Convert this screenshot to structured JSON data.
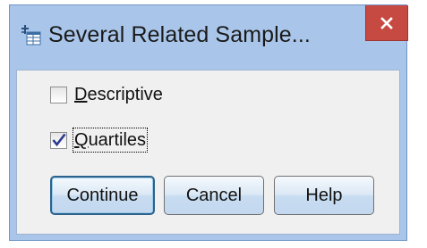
{
  "window": {
    "title": "Several Related Sample...",
    "title_icon": "spss-dialog-icon",
    "close_icon": "close-icon",
    "close_color": "#c74a42",
    "title_bar_color": "#a9c6ea"
  },
  "options": [
    {
      "label_prefix": "",
      "label_mnemonic": "D",
      "label_rest": "escriptive",
      "checked": false
    },
    {
      "label_prefix": "",
      "label_mnemonic": "Q",
      "label_rest": "uartiles",
      "checked": true
    }
  ],
  "buttons": {
    "continue_label": "Continue",
    "cancel_label": "Cancel",
    "help_label": "Help"
  },
  "colors": {
    "check_mark": "#2b3a8f",
    "default_button_border": "#2c628b"
  }
}
